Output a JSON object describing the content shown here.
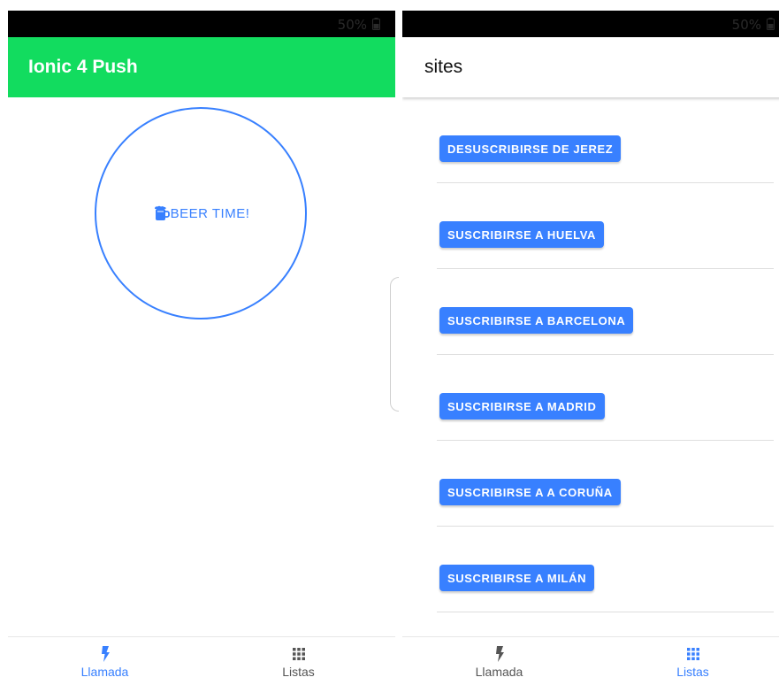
{
  "status_bar": {
    "battery": "50%"
  },
  "left_screen": {
    "header": {
      "title": "Ionic 4 Push",
      "color": "#12dc5f"
    },
    "beer_button": {
      "label": "BEER TIME!",
      "icon": "beer-mug-icon"
    },
    "tabs": [
      {
        "label": "Llamada",
        "icon": "flash-icon",
        "active": true
      },
      {
        "label": "Listas",
        "icon": "apps-grid-icon",
        "active": false
      }
    ]
  },
  "right_screen": {
    "header": {
      "title": "sites"
    },
    "sites": [
      {
        "label": "DESUSCRIBIRSE DE JEREZ"
      },
      {
        "label": "SUSCRIBIRSE A HUELVA"
      },
      {
        "label": "SUSCRIBIRSE A BARCELONA"
      },
      {
        "label": "SUSCRIBIRSE A MADRID"
      },
      {
        "label": "SUSCRIBIRSE A A CORUÑA"
      },
      {
        "label": "SUSCRIBIRSE A MILÁN"
      }
    ],
    "tabs": [
      {
        "label": "Llamada",
        "icon": "flash-icon",
        "active": false
      },
      {
        "label": "Listas",
        "icon": "apps-grid-icon",
        "active": true
      }
    ]
  },
  "colors": {
    "primary": "#3880ff",
    "inactive": "#555555"
  }
}
